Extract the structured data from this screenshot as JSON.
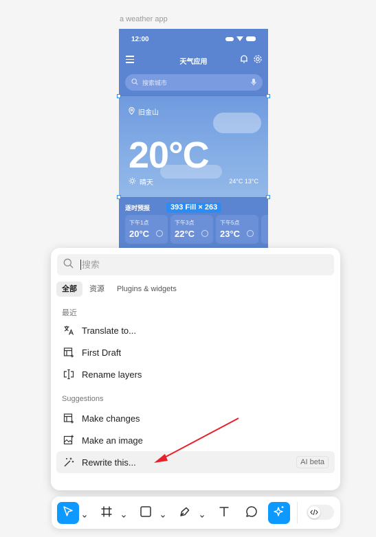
{
  "canvas": {
    "frame_label": "a weather app",
    "phone": {
      "status_time": "12:00",
      "app_title": "天气应用",
      "search_placeholder": "搜索城市",
      "location": "旧金山",
      "temperature": "20°C",
      "condition": "晴天",
      "range": "24°C  13°C",
      "forecast_title": "逐时预报",
      "selection_badge": "393 Fill × 263",
      "hourly": [
        {
          "label": "下午1点",
          "temp": "20°C"
        },
        {
          "label": "下午3点",
          "temp": "22°C"
        },
        {
          "label": "下午5点",
          "temp": "23°C"
        }
      ]
    }
  },
  "popup": {
    "search_placeholder": "搜索",
    "tabs": [
      {
        "label": "全部",
        "active": true
      },
      {
        "label": "资源",
        "active": false
      },
      {
        "label": "Plugins & widgets",
        "active": false
      }
    ],
    "recent_label": "最近",
    "recent_items": [
      {
        "label": "Translate to...",
        "icon": "translate-icon"
      },
      {
        "label": "First Draft",
        "icon": "first-draft-icon"
      },
      {
        "label": "Rename layers",
        "icon": "rename-layers-icon"
      }
    ],
    "suggestions_label": "Suggestions",
    "suggestion_items": [
      {
        "label": "Make changes",
        "icon": "make-changes-icon"
      },
      {
        "label": "Make an image",
        "icon": "image-plus-icon"
      },
      {
        "label": "Rewrite this...",
        "icon": "magic-wand-icon",
        "badge": "AI beta",
        "highlighted": true
      }
    ]
  },
  "toolbar": {
    "tools": [
      "move-icon",
      "frame-icon",
      "rectangle-icon",
      "pen-icon",
      "text-icon",
      "comment-icon",
      "ai-sparkle-icon",
      "dev-mode-icon"
    ],
    "active_tool": "move-icon"
  },
  "colors": {
    "accent": "#0d99ff",
    "phone_bg": "#5b84d1",
    "annotation_arrow": "#e8202a"
  }
}
